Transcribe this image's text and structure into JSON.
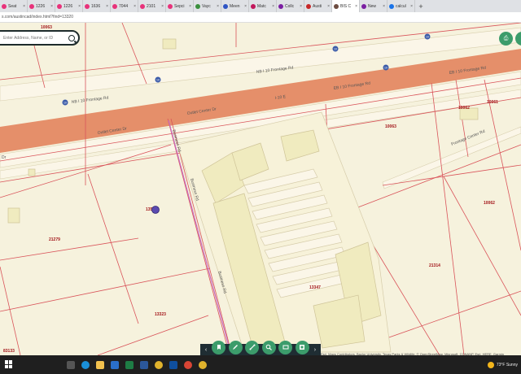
{
  "browser": {
    "tabs": [
      {
        "label": "Seat",
        "color": "#e8327a"
      },
      {
        "label": "1226",
        "color": "#e8327a"
      },
      {
        "label": "1226",
        "color": "#e8327a"
      },
      {
        "label": "1636",
        "color": "#e8327a"
      },
      {
        "label": "7044",
        "color": "#e8327a"
      },
      {
        "label": "2101",
        "color": "#e8327a"
      },
      {
        "label": "Sepci",
        "color": "#e8327a"
      },
      {
        "label": "Vayc",
        "color": "#3a8f3d"
      },
      {
        "label": "Meen",
        "color": "#2f55c4"
      },
      {
        "label": "Matc",
        "color": "#c2185b"
      },
      {
        "label": "Collc",
        "color": "#7b1fa2"
      },
      {
        "label": "Austi",
        "color": "#c62828"
      },
      {
        "label": "BIS C",
        "color": "#6d4c41",
        "active": true
      },
      {
        "label": "New",
        "color": "#7b1fa2"
      },
      {
        "label": "calcul",
        "color": "#1a73e8"
      }
    ],
    "close_glyph": "×",
    "new_tab_glyph": "+",
    "url": "s.com/austincad/index.html?find=13320"
  },
  "search": {
    "placeholder": "Enter Address, Name, or ID"
  },
  "roads": {
    "frontage_north_1": "NB I 10 Frontage Rd",
    "frontage_north_2": "NB I 10 Frontage Rd",
    "frontage_south_1": "EB I 10 Frontage Rd",
    "frontage_south_2": "EB I 10 Frontage Rd",
    "interstate": "I-10 E",
    "outlet_center_1": "Outlet Center Dr",
    "outlet_center_2": "Outlet Center Dr",
    "outlet_center_3": "Outlet Center Dr",
    "frontage_east": "Frontage Center Rd",
    "side_road_1": "Business Rd",
    "side_road_2": "Business Rd",
    "side_road_3": "Business Rd",
    "dr_stub": "Dr"
  },
  "parcels": {
    "p1": "13520",
    "p2": "21279",
    "p3": "13323",
    "p4": "13347",
    "p5": "21314",
    "p6": "10063",
    "p7": "10062",
    "p8": "10062",
    "p9": "10061",
    "p10": "83133",
    "p11": "10063"
  },
  "shields": {
    "i10_a": "10",
    "i10_b": "10",
    "i10_c": "10",
    "i10_d": "10",
    "i10_e": "10"
  },
  "map_buttons": {
    "print": "⎙"
  },
  "toolbar": {
    "prev": "‹",
    "next": "›",
    "tools": [
      "bookmark-icon",
      "draw-icon",
      "measure-icon",
      "identify-icon",
      "basemap-icon",
      "layers-icon"
    ]
  },
  "attribution": "Esri, Maps Contributors, Baylor University, Texas Parks & Wildlife, © OpenStreetMap, Microsoft, CONANP, Esri, HERE, Garmin",
  "taskbar": {
    "weather": "73°F  Sunny"
  },
  "colors": {
    "parcel_line": "#d9545a",
    "highway": "#e38c68",
    "road_fill": "#fbf6e8",
    "building": "#f0ebbf",
    "toolbar_green": "#3c9c6b"
  }
}
